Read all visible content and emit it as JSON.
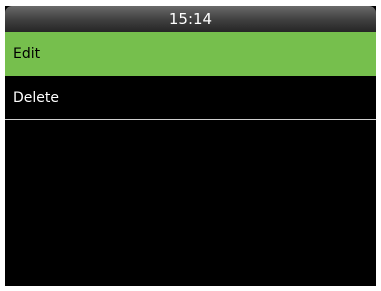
{
  "status_bar": {
    "time": "15:14"
  },
  "menu": {
    "items": [
      {
        "label": "Edit",
        "selected": true
      },
      {
        "label": "Delete",
        "selected": false
      }
    ]
  },
  "colors": {
    "selected_background": "#76bf4d",
    "screen_background": "#000000"
  }
}
